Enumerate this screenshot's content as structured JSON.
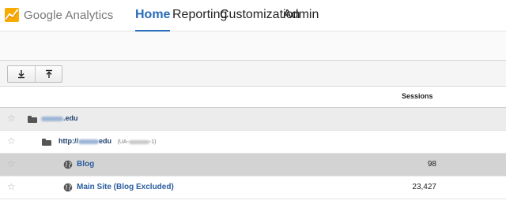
{
  "app": {
    "logo_text": "Google Analytics",
    "accent_color": "#2a6ebb",
    "logo_colors": [
      "#e37400",
      "#f9ab00"
    ]
  },
  "nav": {
    "items": [
      {
        "label": "Home",
        "active": true
      },
      {
        "label": "Reporting",
        "active": false
      },
      {
        "label": "Customization",
        "active": false
      },
      {
        "label": "Admin",
        "active": false
      }
    ]
  },
  "toolbar": {
    "buttons": [
      {
        "icon": "expand-all-icon"
      },
      {
        "icon": "collapse-all-icon"
      }
    ]
  },
  "table": {
    "columns": [
      "Sessions"
    ],
    "rows": [
      {
        "label": ".edu",
        "icon": "folder-icon",
        "sessions": ""
      },
      {
        "label": "http://",
        "label_suffix": "edu",
        "sub": "(UA-",
        "sub_suffix": "-1)",
        "icon": "folder-icon",
        "sessions": ""
      },
      {
        "label": "Blog",
        "icon": "globe-icon",
        "sessions": "98"
      },
      {
        "label": "Main Site (Blog Excluded)",
        "icon": "globe-icon",
        "sessions": "23,427"
      }
    ]
  }
}
